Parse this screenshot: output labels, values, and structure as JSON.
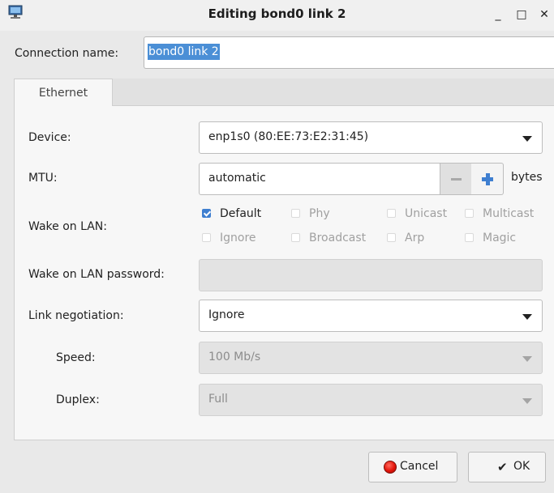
{
  "window": {
    "title": "Editing bond0 link 2",
    "icon": "network-connection-icon",
    "minimize_glyph": "_",
    "maximize_glyph": "□",
    "close_glyph": "✕"
  },
  "connection": {
    "label": "Connection name:",
    "value": "bond0 link 2"
  },
  "tabs": [
    {
      "label": "Ethernet",
      "selected": true
    }
  ],
  "ethernet": {
    "device": {
      "label": "Device:",
      "value": "enp1s0 (80:EE:73:E2:31:45)"
    },
    "mtu": {
      "label": "MTU:",
      "value": "automatic",
      "unit": "bytes"
    },
    "wake_on_lan": {
      "label": "Wake on LAN:",
      "options": [
        {
          "label": "Default",
          "checked": true
        },
        {
          "label": "Phy",
          "checked": false
        },
        {
          "label": "Unicast",
          "checked": false
        },
        {
          "label": "Multicast",
          "checked": false
        },
        {
          "label": "Ignore",
          "checked": false
        },
        {
          "label": "Broadcast",
          "checked": false
        },
        {
          "label": "Arp",
          "checked": false
        },
        {
          "label": "Magic",
          "checked": false
        }
      ]
    },
    "wol_password": {
      "label": "Wake on LAN password:",
      "value": ""
    },
    "link_negotiation": {
      "label": "Link negotiation:",
      "value": "Ignore"
    },
    "speed": {
      "label": "Speed:",
      "value": "100 Mb/s"
    },
    "duplex": {
      "label": "Duplex:",
      "value": "Full"
    }
  },
  "buttons": {
    "cancel_label": "Cancel",
    "ok_label": "OK",
    "ok_glyph": "✔"
  },
  "colors": {
    "accent": "#3f7fd0",
    "selection": "#4b8fd6",
    "cancel_red": "#e3140a"
  }
}
